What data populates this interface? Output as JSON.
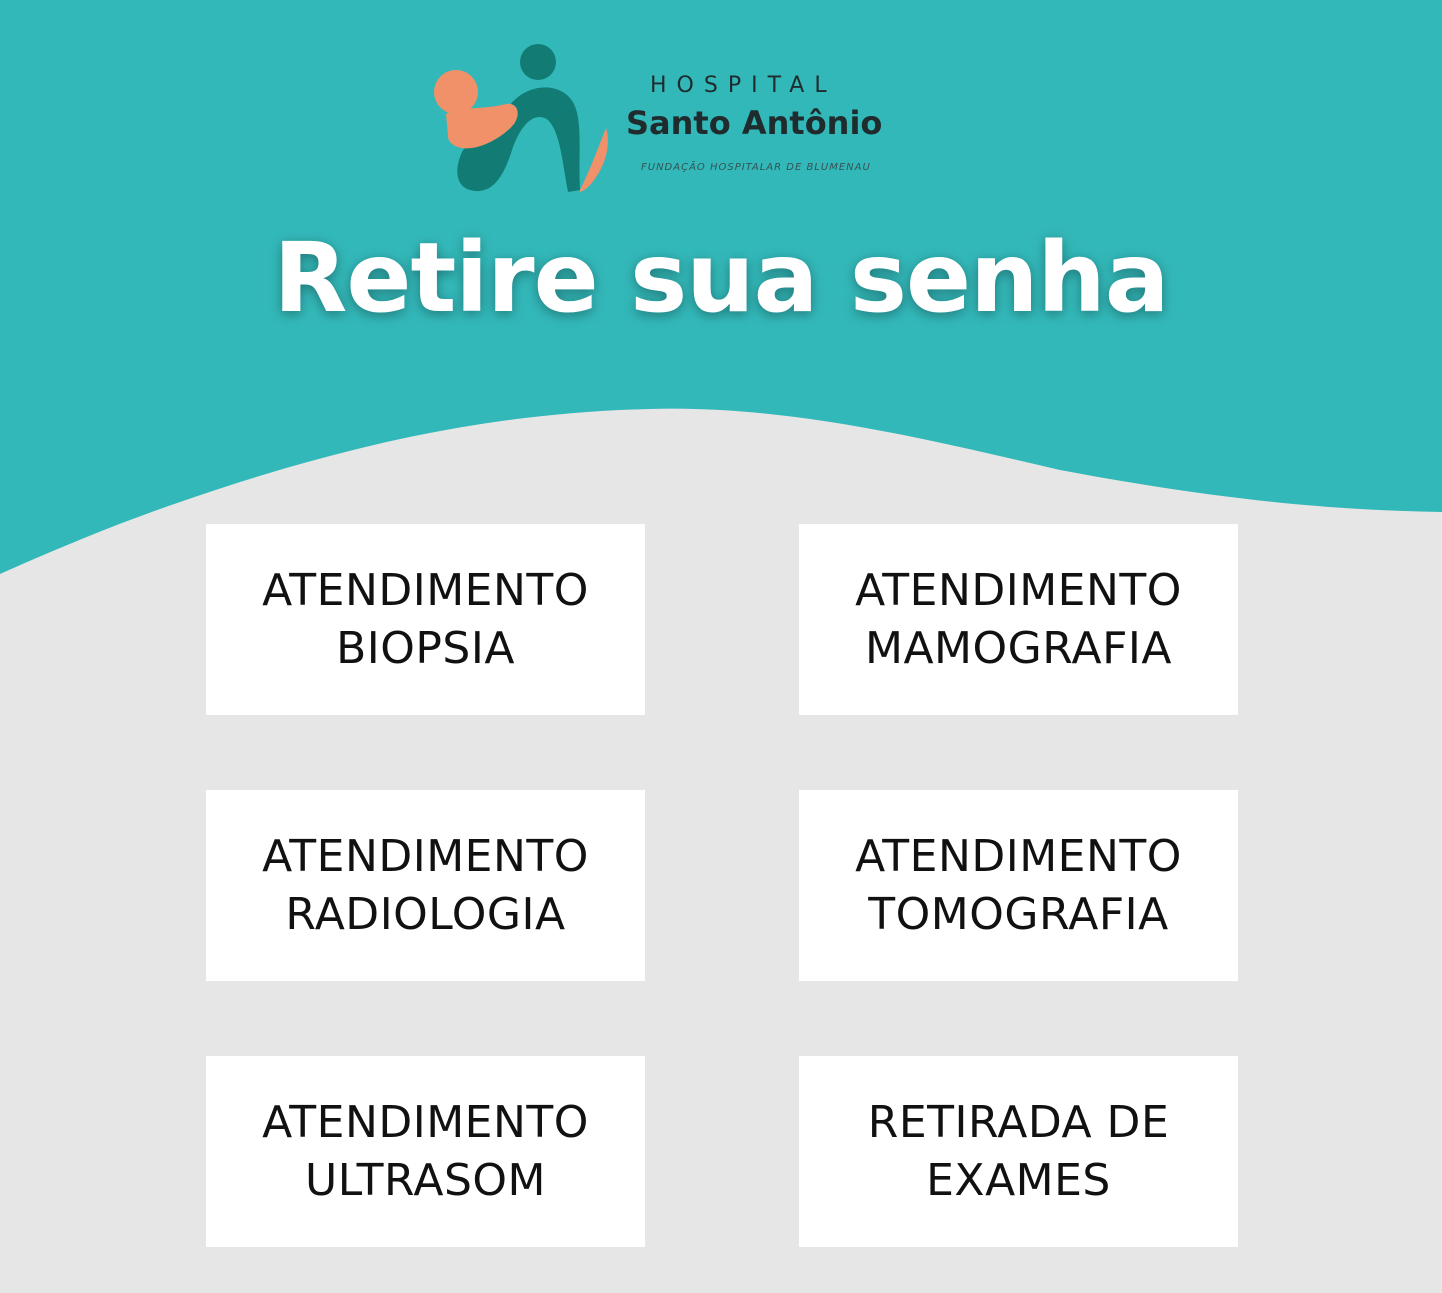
{
  "colors": {
    "header_teal": "#33b8b9",
    "background_gray": "#e6e6e6",
    "tile_white": "#ffffff",
    "logo_dark_teal": "#127c74",
    "logo_salmon": "#f0916a"
  },
  "logo": {
    "line1": "HOSPITAL",
    "line2": "Santo Antônio",
    "line3": "FUNDAÇÃO HOSPITALAR DE BLUMENAU"
  },
  "title": "Retire sua senha",
  "options": [
    {
      "line1": "ATENDIMENTO",
      "line2": "BIOPSIA"
    },
    {
      "line1": "ATENDIMENTO",
      "line2": "MAMOGRAFIA"
    },
    {
      "line1": "ATENDIMENTO",
      "line2": "RADIOLOGIA"
    },
    {
      "line1": "ATENDIMENTO",
      "line2": "TOMOGRAFIA"
    },
    {
      "line1": "ATENDIMENTO",
      "line2": "ULTRASOM"
    },
    {
      "line1": "RETIRADA DE",
      "line2": "EXAMES"
    }
  ]
}
